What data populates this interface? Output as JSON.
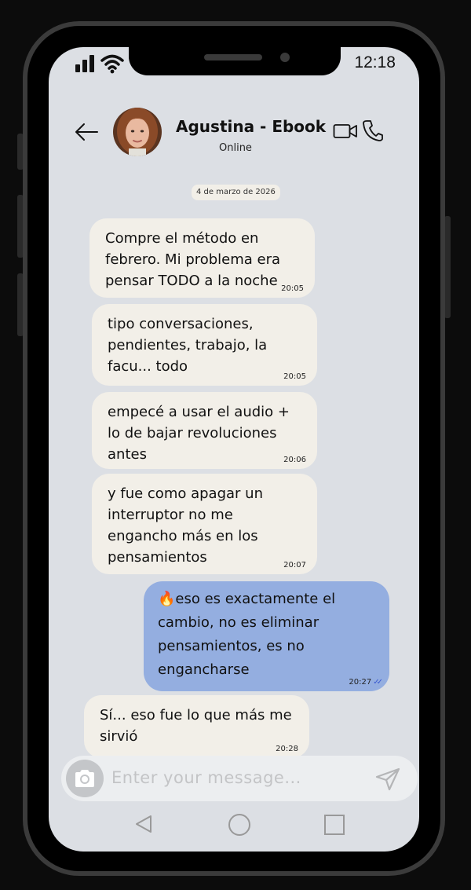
{
  "status_bar": {
    "time": "12:18",
    "icons": [
      "signal-icon",
      "wifi-icon"
    ]
  },
  "header": {
    "back_icon": "arrow-left-icon",
    "contact_name": "Agustina - Ebook",
    "contact_status": "Online",
    "actions": [
      "video-call-icon",
      "phone-call-icon"
    ]
  },
  "chat": {
    "date_chip": "4 de marzo de 2026",
    "messages": [
      {
        "direction": "in",
        "text": "Compre el método en febrero. Mi problema era pensar TODO a la noche",
        "time": "20:05"
      },
      {
        "direction": "in",
        "text": "tipo conversaciones, pendientes, trabajo, la facu... todo",
        "time": "20:05"
      },
      {
        "direction": "in",
        "text": "empecé a usar el audio + lo de bajar revoluciones antes",
        "time": "20:06"
      },
      {
        "direction": "in",
        "text": "y fue como apagar un interruptor no me engancho más en los pensamientos",
        "time": "20:07"
      },
      {
        "direction": "out",
        "emoji": "🔥",
        "text": "eso es exactamente el cambio, no es eliminar pensamientos, es no engancharse",
        "time": "20:27",
        "ticks": "✓✓"
      },
      {
        "direction": "in",
        "text": "Sí... eso fue lo que más me sirvió",
        "time": "20:28"
      }
    ]
  },
  "composer": {
    "placeholder": "Enter your message...",
    "icons": [
      "camera-icon",
      "send-icon"
    ]
  },
  "nav_bar": {
    "icons": [
      "nav-back-icon",
      "nav-home-icon",
      "nav-recents-icon"
    ]
  },
  "colors": {
    "screen_bg": "#dcdfe4",
    "incoming_bubble": "#f2efe8",
    "outgoing_bubble": "#94aee0",
    "frame": "#3b3b3b"
  }
}
